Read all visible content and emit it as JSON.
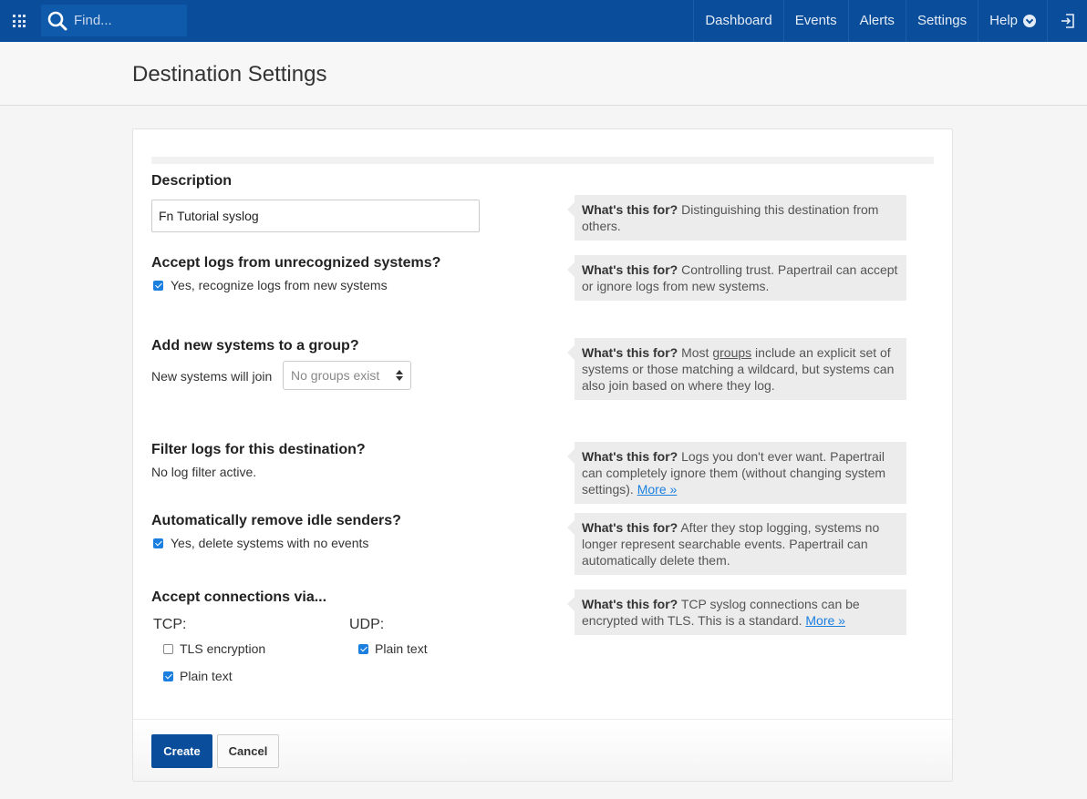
{
  "header": {
    "search_placeholder": "Find...",
    "nav": [
      "Dashboard",
      "Events",
      "Alerts",
      "Settings",
      "Help"
    ]
  },
  "page": {
    "title": "Destination Settings"
  },
  "form": {
    "description": {
      "label": "Description",
      "value": "Fn Tutorial syslog"
    },
    "accept_logs": {
      "label": "Accept logs from unrecognized systems?",
      "checkbox": "Yes, recognize logs from new systems",
      "checked": true
    },
    "group": {
      "label": "Add new systems to a group?",
      "prefix": "New systems will join",
      "select_value": "No groups exist"
    },
    "filter": {
      "label": "Filter logs for this destination?",
      "status": "No log filter active."
    },
    "idle": {
      "label": "Automatically remove idle senders?",
      "checkbox": "Yes, delete systems with no events",
      "checked": true
    },
    "connections": {
      "label": "Accept connections via...",
      "tcp": {
        "label": "TCP:",
        "tls": "TLS encryption",
        "tls_checked": false,
        "plain": "Plain text",
        "plain_checked": true
      },
      "udp": {
        "label": "UDP:",
        "plain": "Plain text",
        "plain_checked": true
      }
    }
  },
  "help": {
    "prefix": "What's this for?",
    "description": "Distinguishing this destination from others.",
    "accept_logs": "Controlling trust. Papertrail can accept or ignore logs from new systems.",
    "group_before": "Most",
    "group_link": "groups",
    "group_after": "include an explicit set of systems or those matching a wildcard, but systems can also join based on where they log.",
    "filter": "Logs you don't ever want. Papertrail can completely ignore them (without changing system settings).",
    "idle": "After they stop logging, systems no longer represent searchable events. Papertrail can automatically delete them.",
    "connections": "TCP syslog connections can be encrypted with TLS. This is a standard.",
    "more_link": "More »"
  },
  "buttons": {
    "create": "Create",
    "cancel": "Cancel"
  },
  "colors": {
    "brand": "#0a4e9b",
    "link": "#1b7fe0"
  }
}
